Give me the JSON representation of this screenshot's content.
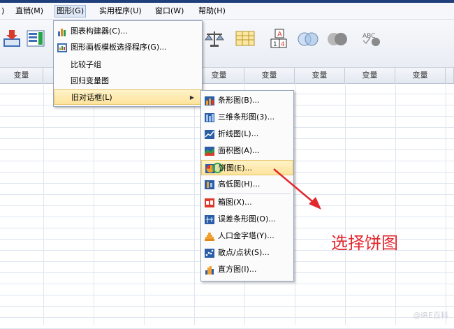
{
  "menubar": {
    "items": [
      ")",
      "直销(M)",
      "图形(G)",
      "实用程序(U)",
      "窗口(W)",
      "帮助(H)"
    ]
  },
  "grid": {
    "column_header": "变量"
  },
  "graphs_menu": {
    "items": [
      "图表构建器(C)...",
      "图形画板模板选择程序(G)...",
      "比较子组",
      "回归变量图",
      "旧对话框(L)"
    ]
  },
  "legacy_submenu": {
    "items": [
      "条形图(B)...",
      "三维条形图(3)...",
      "折线图(L)...",
      "面积图(A)...",
      "饼图(E)...",
      "高低图(H)...",
      "箱图(X)...",
      "误差条形图(O)...",
      "人口金字塔(Y)...",
      "散点/点状(S)...",
      "直方图(I)..."
    ]
  },
  "annotation": {
    "text": "选择饼图",
    "color": "#e2282e"
  },
  "watermark": {
    "text": "@iRE百科"
  }
}
